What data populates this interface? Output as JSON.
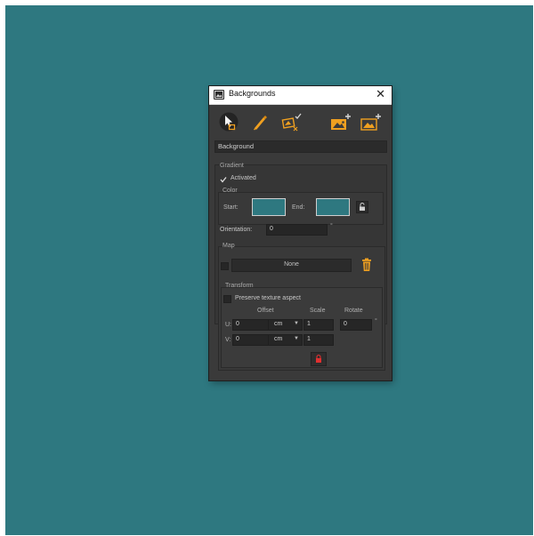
{
  "window": {
    "title": "Backgrounds",
    "close_glyph": "✕"
  },
  "toolbar": {
    "icons": [
      "select-background-icon",
      "pick-color-icon",
      "apply-background-icon",
      "add-image-icon",
      "add-image-alt-icon"
    ]
  },
  "background_name": "Background",
  "gradient": {
    "label": "Gradient",
    "activated_label": "Activated",
    "activated": true,
    "color": {
      "label": "Color",
      "start_label": "Start:",
      "end_label": "End:",
      "start_color": "#2e7880",
      "end_color": "#2e7880"
    },
    "orientation_label": "Orientation:",
    "orientation_value": "0",
    "orientation_unit": "°"
  },
  "map": {
    "label": "Map",
    "value": "None",
    "transform": {
      "label": "Transform",
      "preserve_label": "Preserve texture aspect",
      "offset_label": "Offset",
      "scale_label": "Scale",
      "rotate_label": "Rotate",
      "u_label": "U:",
      "v_label": "V:",
      "u_offset": "0",
      "v_offset": "0",
      "u_unit": "cm",
      "v_unit": "cm",
      "u_scale": "1",
      "v_scale": "1",
      "rotate_value": "0",
      "rotate_unit": "°"
    }
  },
  "colors": {
    "accent": "#f0a020",
    "desktop": "#2e7880",
    "panel": "#3a3a3a",
    "lock_red": "#e03030"
  }
}
